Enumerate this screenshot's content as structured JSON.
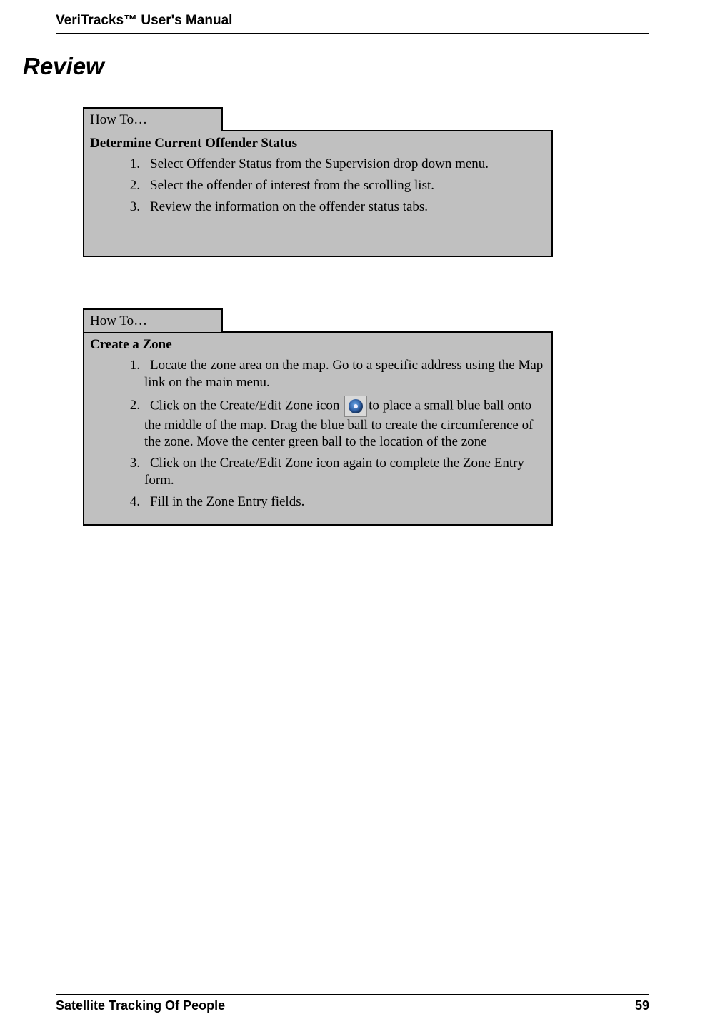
{
  "header": {
    "title": "VeriTracks™ User's Manual"
  },
  "section_title": "Review",
  "howto": [
    {
      "tab": "How To…",
      "title": "Determine Current Offender Status",
      "steps": [
        "Select Offender Status from the Supervision drop down menu.",
        "Select the offender of interest from the scrolling list.",
        "Review the information on the offender status tabs."
      ]
    },
    {
      "tab": "How To…",
      "title": "Create a Zone",
      "steps": [
        "Locate the zone area on the map.  Go to a specific address using the Map link on the main menu.",
        {
          "pre": "Click on the Create/Edit Zone icon ",
          "icon": "zone-target-icon",
          "post": "to place a small blue ball onto the middle of the map.  Drag the blue ball to create the circumference of the zone.  Move the center green ball to the location of the zone"
        },
        "Click on the Create/Edit Zone icon again to complete the Zone Entry form.",
        "Fill in the Zone Entry fields."
      ]
    }
  ],
  "footer": {
    "left": "Satellite Tracking Of People",
    "right": "59"
  }
}
